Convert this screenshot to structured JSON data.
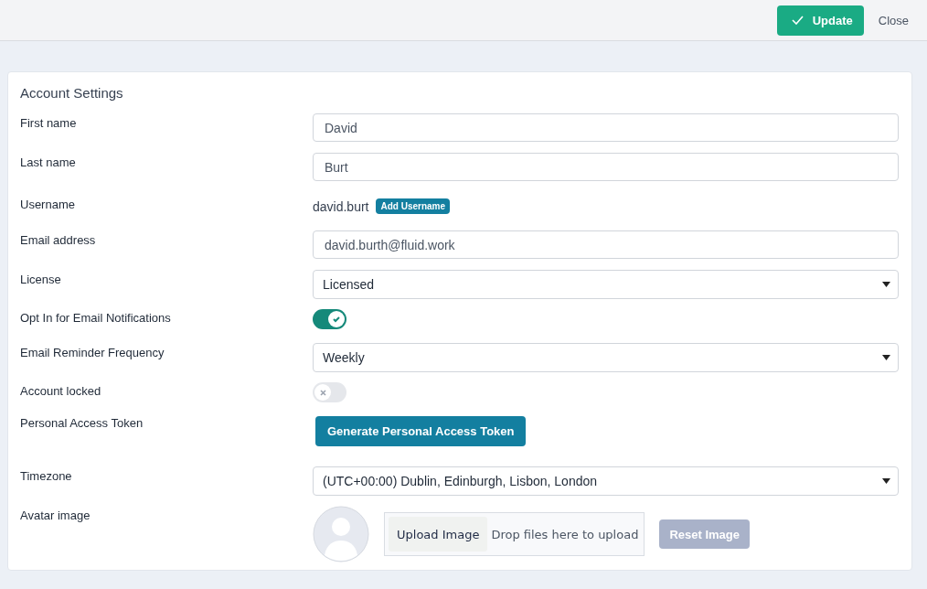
{
  "header": {
    "update_button": "Update",
    "close_button": "Close"
  },
  "card": {
    "title": "Account Settings",
    "rows": [
      {
        "kind": "text",
        "label": "First name",
        "value": "David"
      },
      {
        "kind": "text",
        "label": "Last name",
        "value": "Burt"
      },
      {
        "kind": "static",
        "label": "Username",
        "value": "david.burt",
        "badge": "Add Username"
      },
      {
        "kind": "text",
        "label": "Email address",
        "value": "david.burth@fluid.work"
      },
      {
        "kind": "select",
        "label": "License",
        "value": "Licensed"
      },
      {
        "kind": "toggle",
        "label": "Opt In for Email Notifications",
        "on": true
      },
      {
        "kind": "select",
        "label": "Email Reminder Frequency",
        "value": "Weekly"
      },
      {
        "kind": "toggle",
        "label": "Account locked",
        "on": false
      },
      {
        "kind": "button",
        "label": "Personal Access Token",
        "button": "Generate Personal Access Token"
      },
      {
        "kind": "select",
        "label": "Timezone",
        "value": "(UTC+00:00) Dublin, Edinburgh, Lisbon, London"
      },
      {
        "kind": "avatar",
        "label": "Avatar image",
        "upload": "Upload Image",
        "drop": "Drop files here to upload",
        "reset": "Reset Image",
        "reset_disabled": true
      }
    ]
  }
}
